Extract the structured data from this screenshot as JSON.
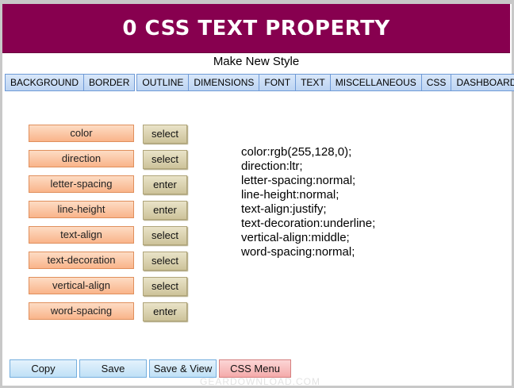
{
  "banner": {
    "title": "0 CSS TEXT PROPERTY"
  },
  "subtitle": "Make New Style",
  "nav": {
    "group1": [
      "BACKGROUND",
      "BORDER"
    ],
    "group2": [
      "OUTLINE",
      "DIMENSIONS",
      "FONT",
      "TEXT",
      "MISCELLANEOUS",
      "CSS",
      "DASHBOARD"
    ]
  },
  "properties": [
    {
      "label": "color",
      "action": "select"
    },
    {
      "label": "direction",
      "action": "select"
    },
    {
      "label": "letter-spacing",
      "action": "enter"
    },
    {
      "label": "line-height",
      "action": "enter"
    },
    {
      "label": "text-align",
      "action": "select"
    },
    {
      "label": "text-decoration",
      "action": "select"
    },
    {
      "label": "vertical-align",
      "action": "select"
    },
    {
      "label": "word-spacing",
      "action": "enter"
    }
  ],
  "output": [
    "color:rgb(255,128,0);",
    "direction:ltr;",
    "letter-spacing:normal;",
    "line-height:normal;",
    "text-align:justify;",
    "text-decoration:underline;",
    "vertical-align:middle;",
    "word-spacing:normal;"
  ],
  "buttons": {
    "copy": "Copy",
    "save": "Save",
    "save_view": "Save & View",
    "css_menu": "CSS Menu"
  },
  "watermark": "GEARDOWNLOAD.COM",
  "colors": {
    "banner": "#87004f",
    "nav": "#c6dcf5",
    "prop_button": "#f9b48a",
    "action_button": "#cdc39a",
    "blue_button": "#bfe0f6",
    "red_button": "#f4aaaa"
  }
}
